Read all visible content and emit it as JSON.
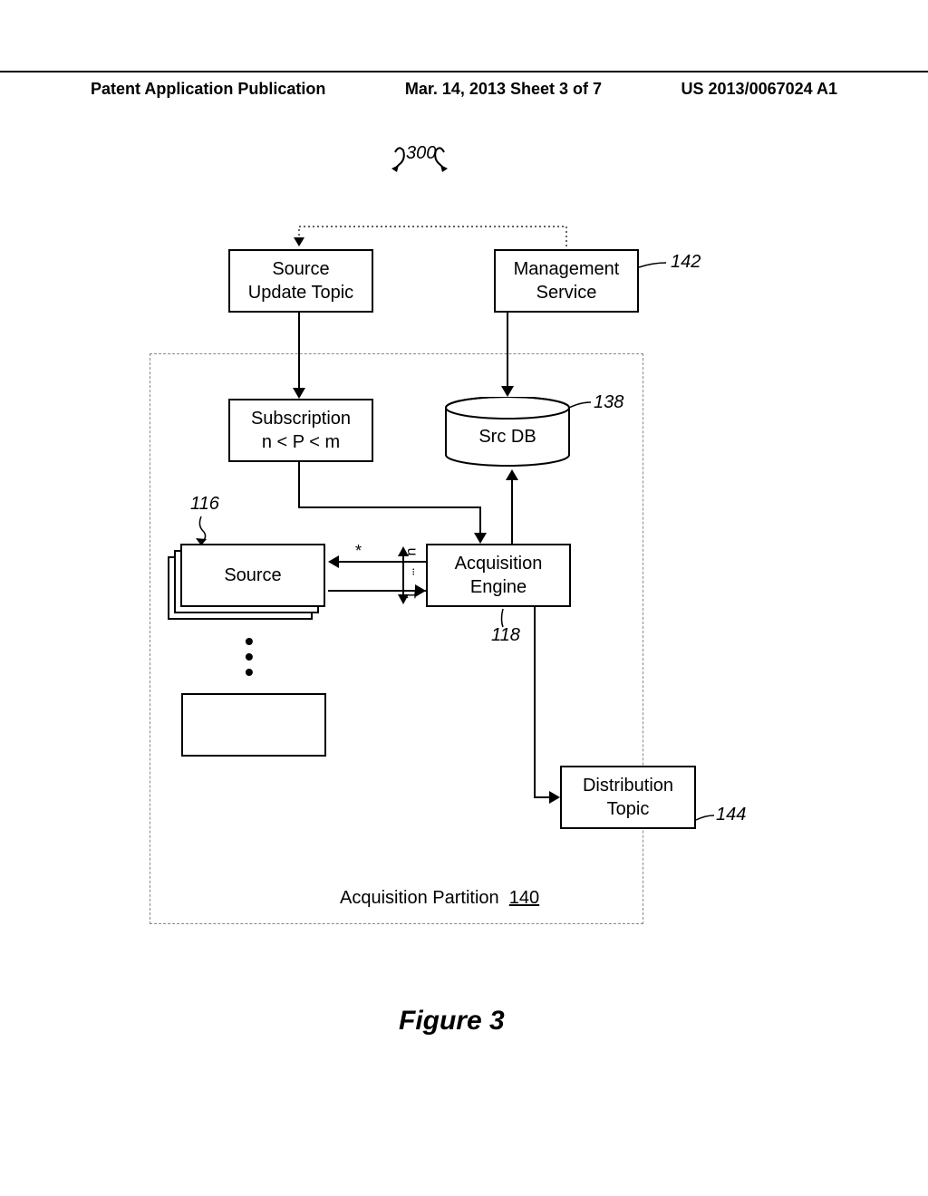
{
  "header": {
    "left": "Patent Application Publication",
    "center": "Mar. 14, 2013  Sheet 3 of 7",
    "right": "US 2013/0067024 A1"
  },
  "refs": {
    "fig_num": "300",
    "mgmt": "142",
    "srcdb": "138",
    "source": "116",
    "engine": "118",
    "dist": "144",
    "partition": "140"
  },
  "boxes": {
    "source_update_topic_l1": "Source",
    "source_update_topic_l2": "Update Topic",
    "management_l1": "Management",
    "management_l2": "Service",
    "subscription_l1": "Subscription",
    "subscription_l2": "n < P < m",
    "srcdb": "Src DB",
    "source": "Source",
    "engine_l1": "Acquisition",
    "engine_l2": "Engine",
    "dist_l1": "Distribution",
    "dist_l2": "Topic",
    "partition": "Acquisition Partition"
  },
  "edge_labels": {
    "star": "*",
    "n": "n",
    "one": "1"
  },
  "caption": "Figure 3"
}
